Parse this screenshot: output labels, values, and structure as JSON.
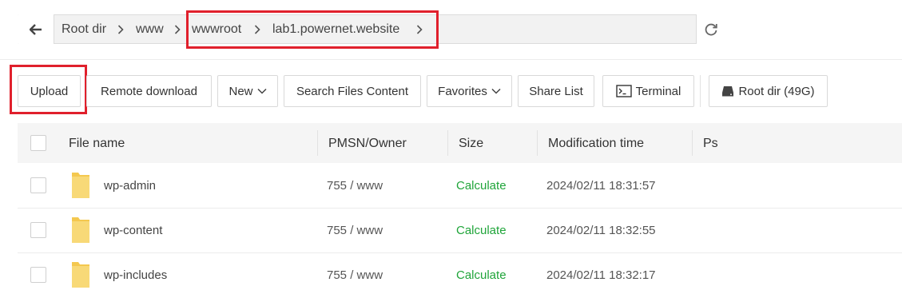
{
  "breadcrumb": {
    "items": [
      "Root dir",
      "www",
      "wwwroot",
      "lab1.powernet.website"
    ]
  },
  "toolbar": {
    "upload": "Upload",
    "remote_download": "Remote download",
    "new": "New",
    "search_files_content": "Search Files Content",
    "favorites": "Favorites",
    "share_list": "Share List",
    "terminal": "Terminal",
    "root_dir": "Root dir (49G)"
  },
  "table": {
    "headers": [
      "File name",
      "PMSN/Owner",
      "Size",
      "Modification time",
      "Ps"
    ],
    "rows": [
      {
        "name": "wp-admin",
        "perm": "755 / www",
        "size": "Calculate",
        "mtime": "2024/02/11 18:31:57"
      },
      {
        "name": "wp-content",
        "perm": "755 / www",
        "size": "Calculate",
        "mtime": "2024/02/11 18:32:55"
      },
      {
        "name": "wp-includes",
        "perm": "755 / www",
        "size": "Calculate",
        "mtime": "2024/02/11 18:32:17"
      }
    ]
  },
  "colors": {
    "highlight": "#e0202c",
    "calculate": "#20a53a",
    "folder": "#f7d46b"
  },
  "icons": [
    "back-arrow-icon",
    "chevron-right-icon",
    "refresh-icon",
    "chevron-down-icon",
    "terminal-icon",
    "disk-icon",
    "folder-icon"
  ]
}
